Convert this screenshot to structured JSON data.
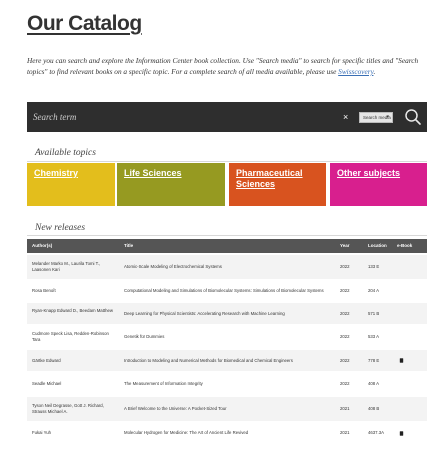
{
  "page": {
    "title": "Our Catalog",
    "intro_text": "Here you can search and explore the Information Center book collection. Use \"Search media\" to search for specific titles and \"Search topics\" to find relevant books on a specific topic. For a complete search of all media available, please use ",
    "intro_link": "Swisscovery",
    "intro_end": "."
  },
  "search": {
    "placeholder": "Search term",
    "clear_label": "×",
    "select_value": "Search media"
  },
  "topics": {
    "heading": "Available topics",
    "items": [
      {
        "label": "Chemistry",
        "color": "#e3be1c"
      },
      {
        "label": "Life Sciences",
        "color": "#969a21"
      },
      {
        "label": "Pharmaceutical Sciences",
        "color": "#d8531f"
      },
      {
        "label": "Other subjects",
        "color": "#d81f8e"
      }
    ]
  },
  "releases": {
    "heading": "New releases",
    "columns": [
      "Author(s)",
      "Title",
      "Year",
      "Location",
      "e-Book"
    ],
    "rows": [
      {
        "author": "Melander Marko M., Laurila Tomi T., Laasonen Kari",
        "title": "Atomic-Scale Modeling of Electrochemical Systems",
        "year": "2022",
        "location": "133 E",
        "ebook": false
      },
      {
        "author": "Rosa Benoît",
        "title": "Computational Modeling and Simulations of Biomolecular Systems: Simulations of Biomolecular Systems",
        "year": "2022",
        "location": "204 A",
        "ebook": false
      },
      {
        "author": "Ryan-Knapp Edward D., Beedam Matthew",
        "title": "Deep Learning for Physical Scientists: Accelerating Research with Machine Learning",
        "year": "2022",
        "location": "571 B",
        "ebook": false
      },
      {
        "author": "Cudmore Speck Lisa, Redden-Robinson Tara",
        "title": "Genetik für Dummies",
        "year": "2022",
        "location": "533 A",
        "ebook": false
      },
      {
        "author": "Gärtke Edward",
        "title": "Introduction to Modeling and Numerical Methods for Biomedical and Chemical Engineers",
        "year": "2022",
        "location": "778 E",
        "ebook": true
      },
      {
        "author": "Seadle Michael",
        "title": "The Measurement of Information Integrity",
        "year": "2022",
        "location": "408 A",
        "ebook": false
      },
      {
        "author": "Tyson Neil Degrasse, Gott J. Richard, Strauss Michael A.",
        "title": "A Brief Welcome to the Universe: A Pocket-Sized Tour",
        "year": "2021",
        "location": "408 B",
        "ebook": false
      },
      {
        "author": "Fukai Yuh",
        "title": "Molecular Hydrogen for Medicine: The Art of Ancient Life Revived",
        "year": "2021",
        "location": "4637.3A",
        "ebook": true
      }
    ]
  }
}
